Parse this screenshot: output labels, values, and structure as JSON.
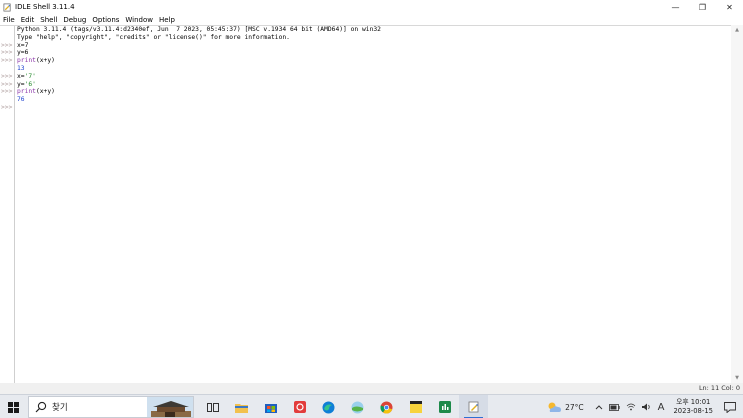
{
  "window": {
    "title": "IDLE Shell 3.11.4",
    "minimize": "—",
    "restore": "❐",
    "close": "✕"
  },
  "menu": [
    "File",
    "Edit",
    "Shell",
    "Debug",
    "Options",
    "Window",
    "Help"
  ],
  "shell": {
    "banner_line1": "Python 3.11.4 (tags/v3.11.4:d2340ef, Jun  7 2023, 05:45:37) [MSC v.1934 64 bit (AMD64)] on win32",
    "banner_line2": "Type \"help\", \"copyright\", \"credits\" or \"license()\" for more information.",
    "prompt": ">>>",
    "lines": [
      {
        "kind": "input",
        "text": "x=7"
      },
      {
        "kind": "input",
        "text": "y=6"
      },
      {
        "kind": "input_print",
        "fn": "print",
        "arg": "(x+y)"
      },
      {
        "kind": "output",
        "text": "13"
      },
      {
        "kind": "input_str",
        "pre": "x=",
        "str": "'7'"
      },
      {
        "kind": "input_str",
        "pre": "y=",
        "str": "'6'"
      },
      {
        "kind": "input_print",
        "fn": "print",
        "arg": "(x+y)"
      },
      {
        "kind": "output",
        "text": "76"
      },
      {
        "kind": "prompt_only",
        "text": ""
      }
    ]
  },
  "status": {
    "text": "Ln: 11  Col: 0"
  },
  "taskbar": {
    "search_placeholder": "찾기",
    "weather_temp": "27°C",
    "ime": "A",
    "clock_time": "오후 10:01",
    "clock_date": "2023-08-15"
  },
  "colors": {
    "keyword": "#8a33a8",
    "string": "#22882a",
    "output": "#1a3ecf",
    "prompt": "#b0a0a0"
  }
}
